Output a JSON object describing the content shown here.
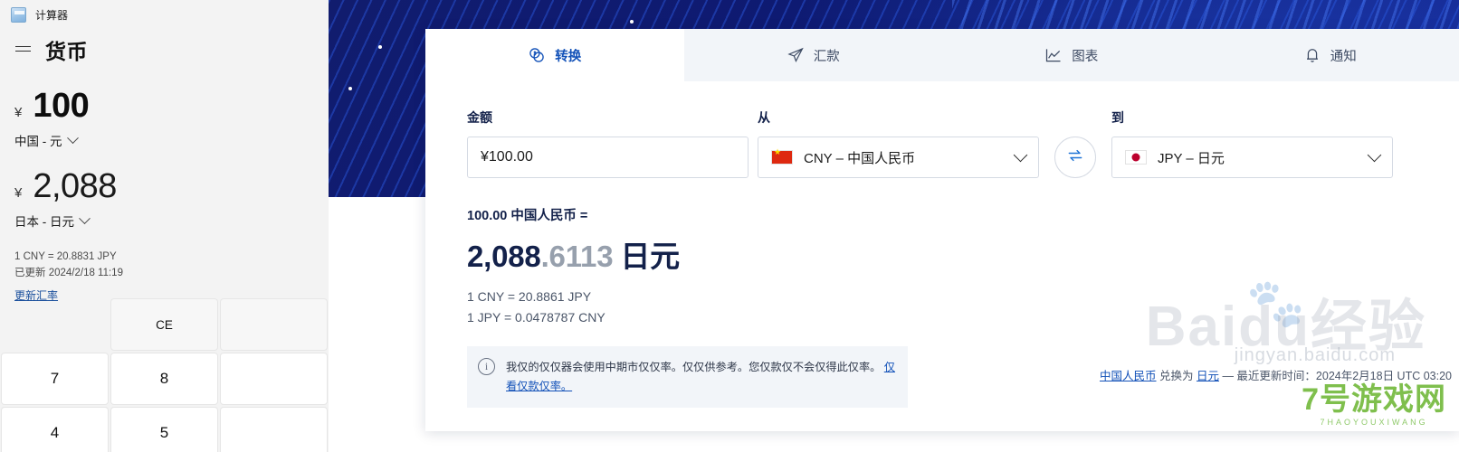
{
  "calculator": {
    "app_title": "计算器",
    "app_icon": "calculator-icon",
    "menu_icon": "hamburger-menu-icon",
    "mode_title": "货币",
    "from": {
      "symbol": "¥",
      "amount": "100",
      "currency_label": "中国 - 元",
      "chevron_icon": "chevron-down-icon"
    },
    "to": {
      "symbol": "¥",
      "amount": "2,088",
      "currency_label": "日本 - 日元",
      "chevron_icon": "chevron-down-icon"
    },
    "rate_line": "1 CNY = 20.8831 JPY",
    "updated_line": "已更新 2024/2/18 11:19",
    "update_link": "更新汇率",
    "keys": [
      "CE",
      "",
      "7",
      "8",
      "",
      "4",
      "5",
      ""
    ]
  },
  "web": {
    "tabs": [
      {
        "label": "转换",
        "icon": "coin-exchange-icon",
        "active": true
      },
      {
        "label": "汇款",
        "icon": "paper-plane-icon",
        "active": false
      },
      {
        "label": "图表",
        "icon": "line-chart-icon",
        "active": false
      },
      {
        "label": "通知",
        "icon": "bell-icon",
        "active": false
      }
    ],
    "form": {
      "amount_label": "金额",
      "amount_value": "¥100.00",
      "from_label": "从",
      "from_currency": "CNY – 中国人民币",
      "from_flag": "flag-china-icon",
      "to_label": "到",
      "to_currency": "JPY – 日元",
      "to_flag": "flag-japan-icon",
      "swap_icon": "swap-arrows-icon",
      "chevron_icon": "chevron-down-icon"
    },
    "result": {
      "from_line": "100.00 中国人民币 =",
      "value_int": "2,088",
      "value_dec": ".6113",
      "unit": "日元",
      "rate_1": "1 CNY = 20.8861 JPY",
      "rate_2": "1 JPY = 0.0478787 CNY"
    },
    "notice": {
      "icon": "info-icon",
      "text": "我仅的仅仅器会使用中期市仅仅率。仅仅供参考。您仅款仅不会仅得此仅率。",
      "link": "仅看仅款仅率。"
    },
    "footnote": {
      "link_from": "中国人民币",
      "mid": " 兑换为 ",
      "link_to": "日元",
      "tail": " — 最近更新时间：2024年2月18日 UTC 03:20"
    }
  },
  "watermarks": {
    "baidu": "Baidu",
    "baidu_cn": "经验",
    "baidu_sub": "jingyan.baidu.com",
    "game_main": "7号游戏网",
    "game_sub": "7HAOYOUXIWANG"
  },
  "colors": {
    "accent": "#1251b8",
    "hero": "#111c6e",
    "text_dark": "#13214a"
  }
}
